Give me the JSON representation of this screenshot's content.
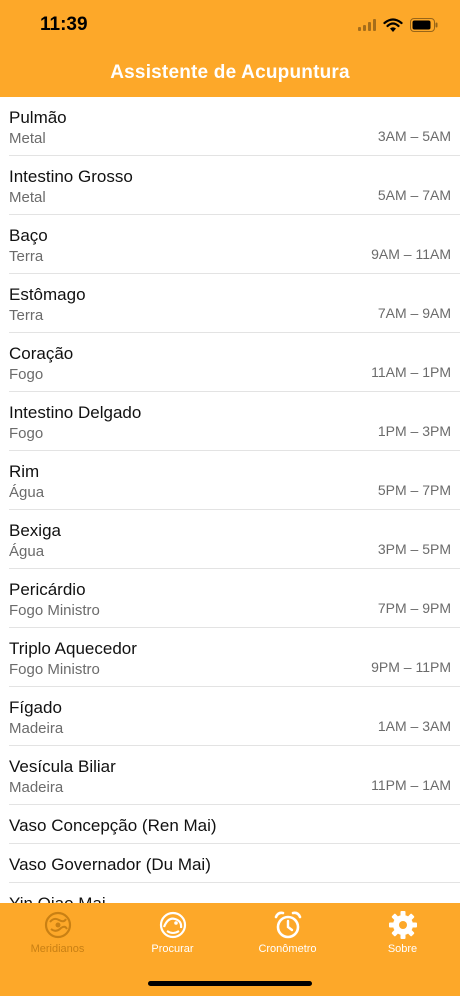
{
  "status": {
    "time": "11:39"
  },
  "header": {
    "title": "Assistente de Acupuntura"
  },
  "meridians": [
    {
      "name": "Pulmão",
      "element": "Metal",
      "time": "3AM – 5AM"
    },
    {
      "name": "Intestino Grosso",
      "element": "Metal",
      "time": "5AM – 7AM"
    },
    {
      "name": "Baço",
      "element": "Terra",
      "time": "9AM – 11AM"
    },
    {
      "name": "Estômago",
      "element": "Terra",
      "time": "7AM – 9AM"
    },
    {
      "name": "Coração",
      "element": "Fogo",
      "time": "11AM – 1PM"
    },
    {
      "name": "Intestino Delgado",
      "element": "Fogo",
      "time": "1PM – 3PM"
    },
    {
      "name": "Rim",
      "element": "Água",
      "time": "5PM – 7PM"
    },
    {
      "name": "Bexiga",
      "element": "Água",
      "time": "3PM – 5PM"
    },
    {
      "name": "Pericárdio",
      "element": "Fogo Ministro",
      "time": "7PM – 9PM"
    },
    {
      "name": "Triplo Aquecedor",
      "element": "Fogo Ministro",
      "time": "9PM – 11PM"
    },
    {
      "name": "Fígado",
      "element": "Madeira",
      "time": "1AM – 3AM"
    },
    {
      "name": "Vesícula Biliar",
      "element": "Madeira",
      "time": "11PM – 1AM"
    }
  ],
  "extra_vessels": [
    {
      "name": "Vaso Concepção (Ren Mai)"
    },
    {
      "name": "Vaso Governador (Du Mai)"
    },
    {
      "name": "Yin Qiao Mai"
    }
  ],
  "tabs": [
    {
      "label": "Meridianos",
      "icon": "meridians-icon",
      "active": true
    },
    {
      "label": "Procurar",
      "icon": "search-dragon-icon",
      "active": false
    },
    {
      "label": "Cronômetro",
      "icon": "alarm-clock-icon",
      "active": false
    },
    {
      "label": "Sobre",
      "icon": "gear-icon",
      "active": false
    }
  ],
  "colors": {
    "accent": "#fda829",
    "active_tab": "#c98014",
    "secondary_text": "#6b6b6b"
  }
}
